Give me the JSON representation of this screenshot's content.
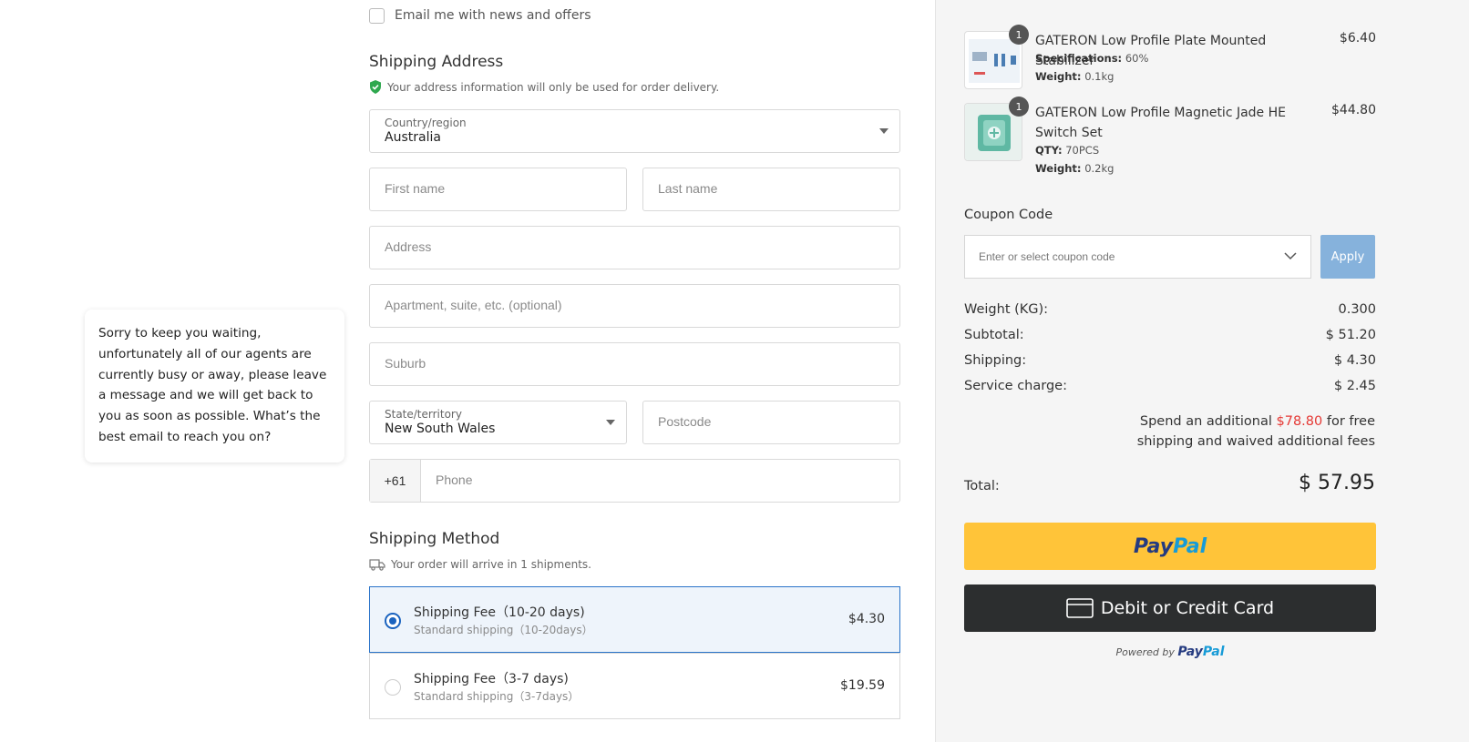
{
  "chat": {
    "message": "Sorry to keep you waiting, unfortunately all of our agents are currently busy or away, please leave a message and we will get back to you as soon as possible. What’s the best email to reach you on?"
  },
  "newsletter": {
    "label": "Email me with news and offers",
    "checked": false
  },
  "shipping_address": {
    "title": "Shipping Address",
    "note": "Your address information will only be used for order delivery.",
    "country_label": "Country/region",
    "country_value": "Australia",
    "first_name_placeholder": "First name",
    "last_name_placeholder": "Last name",
    "address_placeholder": "Address",
    "apartment_placeholder": "Apartment, suite, etc. (optional)",
    "suburb_placeholder": "Suburb",
    "state_label": "State/territory",
    "state_value": "New South Wales",
    "postcode_placeholder": "Postcode",
    "phone_prefix": "+61",
    "phone_placeholder": "Phone"
  },
  "shipping_method": {
    "title": "Shipping Method",
    "note": "Your order will arrive in 1 shipments.",
    "options": [
      {
        "title": "Shipping Fee（10-20 days)",
        "subtitle": "Standard shipping（10-20days）",
        "price": "$4.30",
        "selected": true
      },
      {
        "title": "Shipping Fee（3-7 days)",
        "subtitle": "Standard shipping（3-7days）",
        "price": "$19.59",
        "selected": false
      }
    ]
  },
  "cart": {
    "items": [
      {
        "qty": "1",
        "name": "GATERON Low Profile Plate Mounted Stabilizer",
        "price": "$6.40",
        "specs": [
          {
            "label": "Specifications:",
            "value": "60%"
          },
          {
            "label": "Weight:",
            "value": "0.1kg"
          }
        ]
      },
      {
        "qty": "1",
        "name": "GATERON Low Profile Magnetic Jade HE Switch Set",
        "price": "$44.80",
        "specs": [
          {
            "label": "QTY:",
            "value": "70PCS"
          },
          {
            "label": "Weight:",
            "value": "0.2kg"
          }
        ]
      }
    ]
  },
  "coupon": {
    "title": "Coupon Code",
    "placeholder": "Enter or select coupon code",
    "apply_label": "Apply"
  },
  "summary": {
    "weight_label": "Weight (KG):",
    "weight_value": "0.300",
    "subtotal_label": "Subtotal:",
    "subtotal_value": "$ 51.20",
    "shipping_label": "Shipping:",
    "shipping_value": "$ 4.30",
    "service_label": "Service charge:",
    "service_value": "$ 2.45",
    "promo_prefix": "Spend an additional ",
    "promo_amount": "$78.80",
    "promo_suffix": " for free shipping and waived additional fees",
    "total_label": "Total:",
    "total_value": "$ 57.95"
  },
  "payment": {
    "paypal_pay": "Pay",
    "paypal_pal": "Pal",
    "card_label": "Debit or Credit Card",
    "powered_by": "Powered by"
  },
  "colors": {
    "accent": "#1b63bf",
    "promo_red": "#e53935",
    "paypal_yellow": "#ffc439",
    "card_dark": "#2c2e2f",
    "apply_blue": "#86b2dc"
  },
  "icons": [
    "shield-check-icon",
    "truck-icon",
    "chevron-down-icon",
    "credit-card-icon"
  ]
}
